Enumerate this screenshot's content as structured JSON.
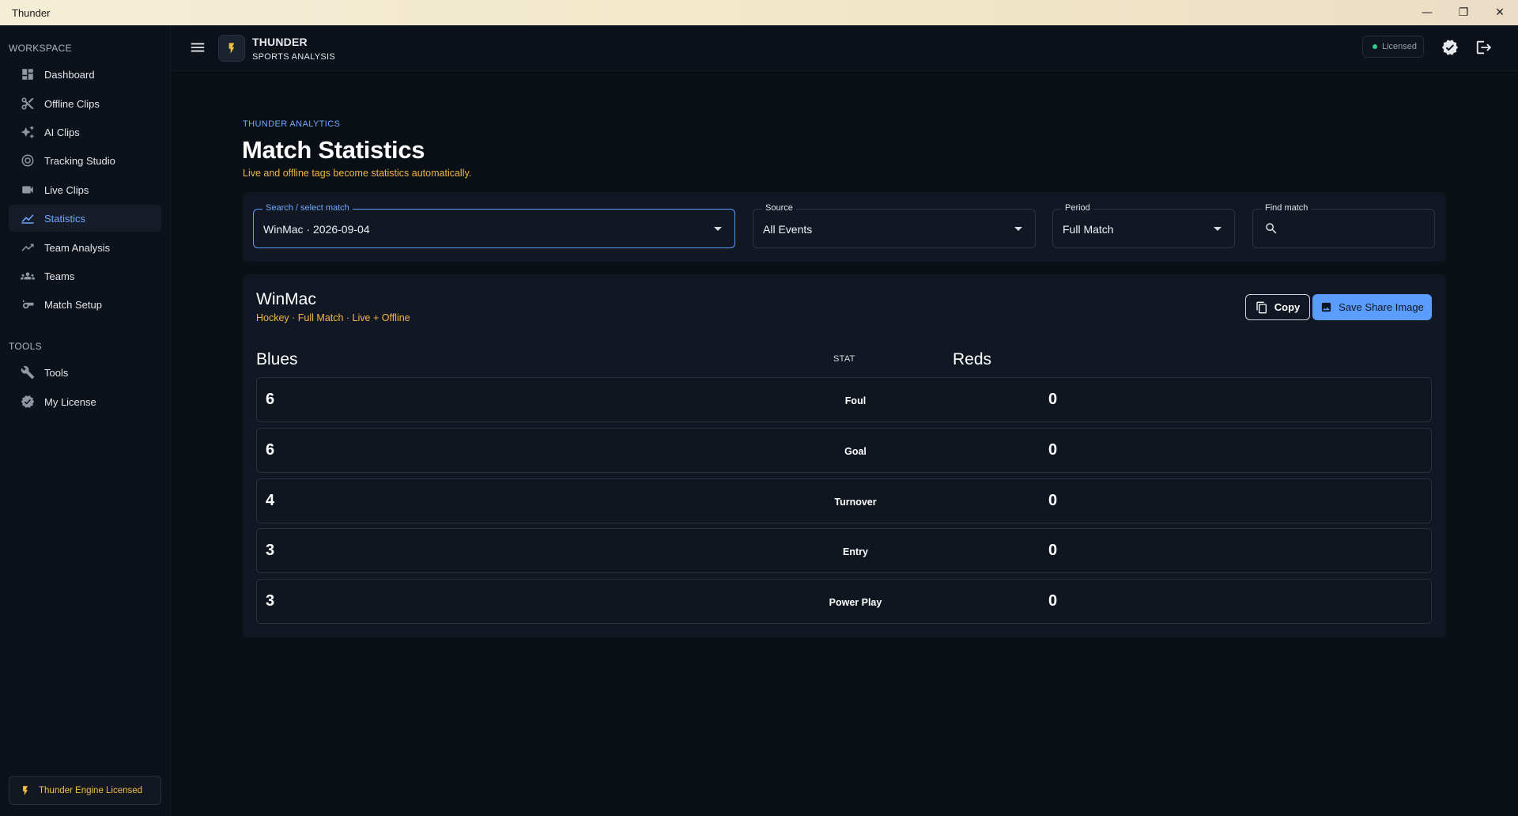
{
  "window": {
    "title": "Thunder",
    "minimize": "—",
    "maximize": "❐",
    "close": "✕"
  },
  "sidebar": {
    "workspace_label": "WORKSPACE",
    "tools_label": "TOOLS",
    "items": [
      {
        "label": "Dashboard",
        "icon": "dashboard-icon"
      },
      {
        "label": "Offline Clips",
        "icon": "scissors-icon"
      },
      {
        "label": "AI Clips",
        "icon": "sparkles-icon"
      },
      {
        "label": "Tracking Studio",
        "icon": "target-icon"
      },
      {
        "label": "Live Clips",
        "icon": "video-camera-icon"
      },
      {
        "label": "Statistics",
        "icon": "chart-line-icon",
        "active": true
      },
      {
        "label": "Team Analysis",
        "icon": "trend-icon"
      },
      {
        "label": "Teams",
        "icon": "group-icon"
      },
      {
        "label": "Match Setup",
        "icon": "whistle-icon"
      }
    ],
    "tools": [
      {
        "label": "Tools",
        "icon": "wrench-icon"
      },
      {
        "label": "My License",
        "icon": "verified-icon"
      }
    ],
    "engine_badge": "Thunder Engine Licensed"
  },
  "header": {
    "brand_title": "THUNDER",
    "brand_sub": "SPORTS ANALYSIS",
    "license_status": "Licensed",
    "status_color": "#2fc98a"
  },
  "page": {
    "eyebrow": "THUNDER ANALYTICS",
    "title": "Match Statistics",
    "subtitle": "Live and offline tags become statistics automatically."
  },
  "filters": {
    "match": {
      "label": "Search / select match",
      "value": "WinMac · 2026-09-04"
    },
    "source": {
      "label": "Source",
      "value": "All Events"
    },
    "period": {
      "label": "Period",
      "value": "Full Match"
    },
    "find": {
      "label": "Find match",
      "placeholder": ""
    }
  },
  "stats": {
    "match_name": "WinMac",
    "meta": "Hockey · Full Match · Live + Offline",
    "copy_label": "Copy",
    "share_label": "Save Share Image",
    "left_team": "Blues",
    "stat_header": "STAT",
    "right_team": "Reds",
    "rows": [
      {
        "left": "6",
        "stat": "Foul",
        "right": "0"
      },
      {
        "left": "6",
        "stat": "Goal",
        "right": "0"
      },
      {
        "left": "4",
        "stat": "Turnover",
        "right": "0"
      },
      {
        "left": "3",
        "stat": "Entry",
        "right": "0"
      },
      {
        "left": "3",
        "stat": "Power Play",
        "right": "0"
      }
    ]
  },
  "colors": {
    "accent": "#5b9dff",
    "highlight": "#f0b545",
    "background": "#0b0f16"
  }
}
